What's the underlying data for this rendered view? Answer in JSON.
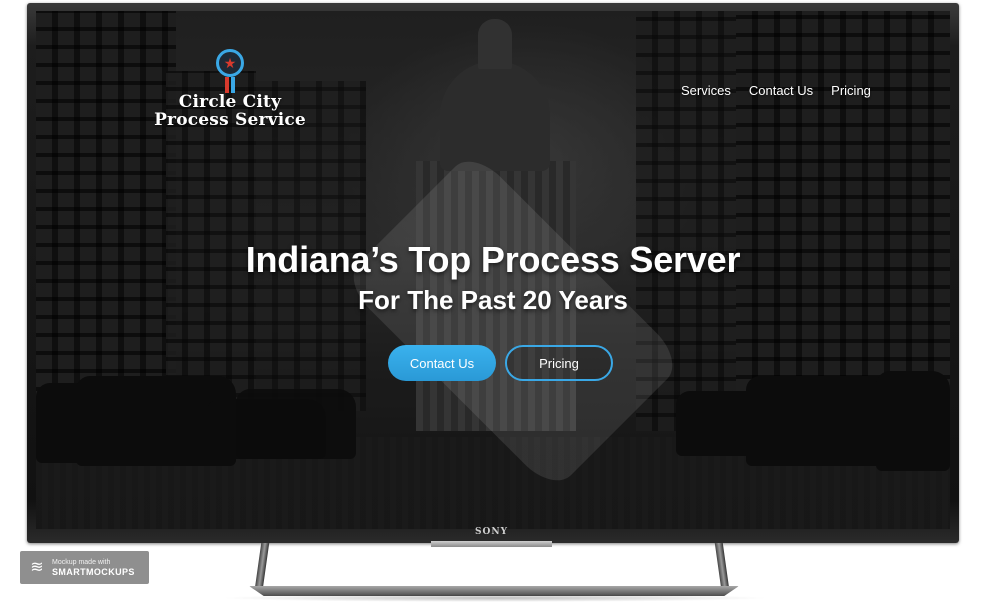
{
  "logo": {
    "line1": "Circle City",
    "line2": "Process Service",
    "star": "★"
  },
  "nav": {
    "items": [
      {
        "label": "Services"
      },
      {
        "label": "Contact Us"
      },
      {
        "label": "Pricing"
      }
    ]
  },
  "hero": {
    "title": "Indiana’s Top Process Server",
    "subtitle": "For The Past 20 Years",
    "primary_button": "Contact Us",
    "secondary_button": "Pricing"
  },
  "device": {
    "brand": "SONY"
  },
  "watermark": {
    "small": "Mockup made with",
    "big": "SMARTMOCKUPS",
    "icon": "layers-icon"
  },
  "colors": {
    "accent": "#3aa8e6",
    "logo_red": "#d83a2d"
  }
}
